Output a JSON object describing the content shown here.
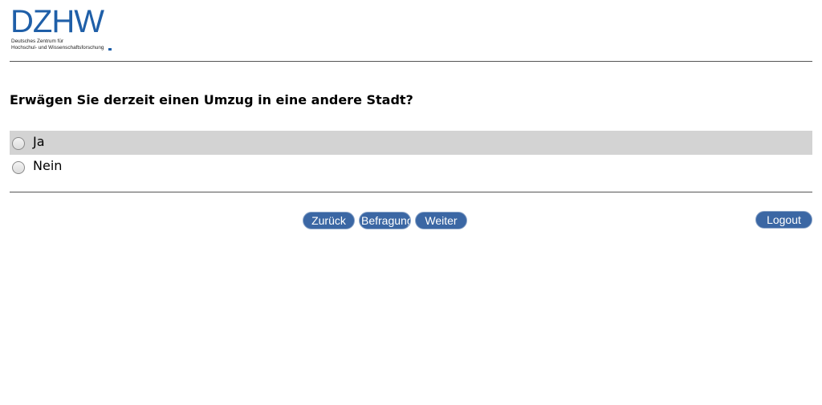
{
  "logo": {
    "wordmark": "DZHW",
    "line1": "Deutsches Zentrum für",
    "line2": "Hochschul- und Wissenschaftsforschung",
    "color": "#1f5fa8"
  },
  "question": {
    "text": "Erwägen Sie derzeit einen Umzug in eine andere Stadt?"
  },
  "options": [
    {
      "label": "Ja",
      "selected": false,
      "highlighted": true
    },
    {
      "label": "Nein",
      "selected": false,
      "highlighted": false
    }
  ],
  "navigation": {
    "back_label": "Zurück",
    "survey_label": "Befragung",
    "next_label": "Weiter",
    "logout_label": "Logout",
    "button_color": "#3b67a4"
  },
  "colors": {
    "highlight_row": "#d3d3d3",
    "rule": "#555555"
  }
}
